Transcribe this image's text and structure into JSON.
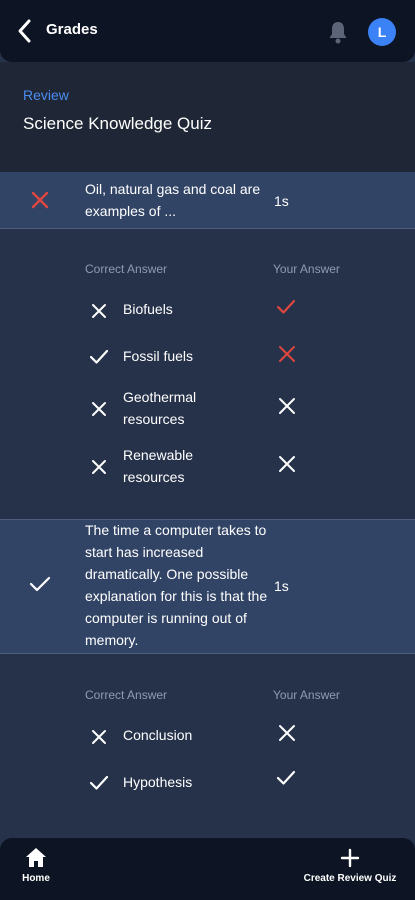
{
  "topbar": {
    "title": "Grades",
    "avatar_initial": "L"
  },
  "header": {
    "review_label": "Review",
    "quiz_title": "Science Knowledge Quiz"
  },
  "questions": [
    {
      "text": "Oil, natural gas and coal are examples of ...",
      "time": "1s",
      "result": "incorrect",
      "correct_answer_header": "Correct Answer",
      "your_answer_header": "Your Answer",
      "options": [
        {
          "label": "Biofuels",
          "correct": false,
          "your_answer": "selected-wrong"
        },
        {
          "label": "Fossil fuels",
          "correct": true,
          "your_answer": "missed"
        },
        {
          "label": "Geothermal resources",
          "correct": false,
          "your_answer": "not-selected"
        },
        {
          "label": "Renewable resources",
          "correct": false,
          "your_answer": "not-selected"
        }
      ]
    },
    {
      "text": "The time a computer takes to start has increased dramatically. One possible explanation for this is that the computer is running out of memory.",
      "time": "1s",
      "result": "correct",
      "correct_answer_header": "Correct Answer",
      "your_answer_header": "Your Answer",
      "options": [
        {
          "label": "Conclusion",
          "correct": false,
          "your_answer": "not-selected"
        },
        {
          "label": "Hypothesis",
          "correct": true,
          "your_answer": "selected-correct"
        }
      ]
    }
  ],
  "nav": {
    "home_label": "Home",
    "create_label": "Create Review Quiz"
  },
  "colors": {
    "accent": "#4b8df0",
    "wrong": "#e0463e",
    "avatar": "#3b82f6"
  }
}
